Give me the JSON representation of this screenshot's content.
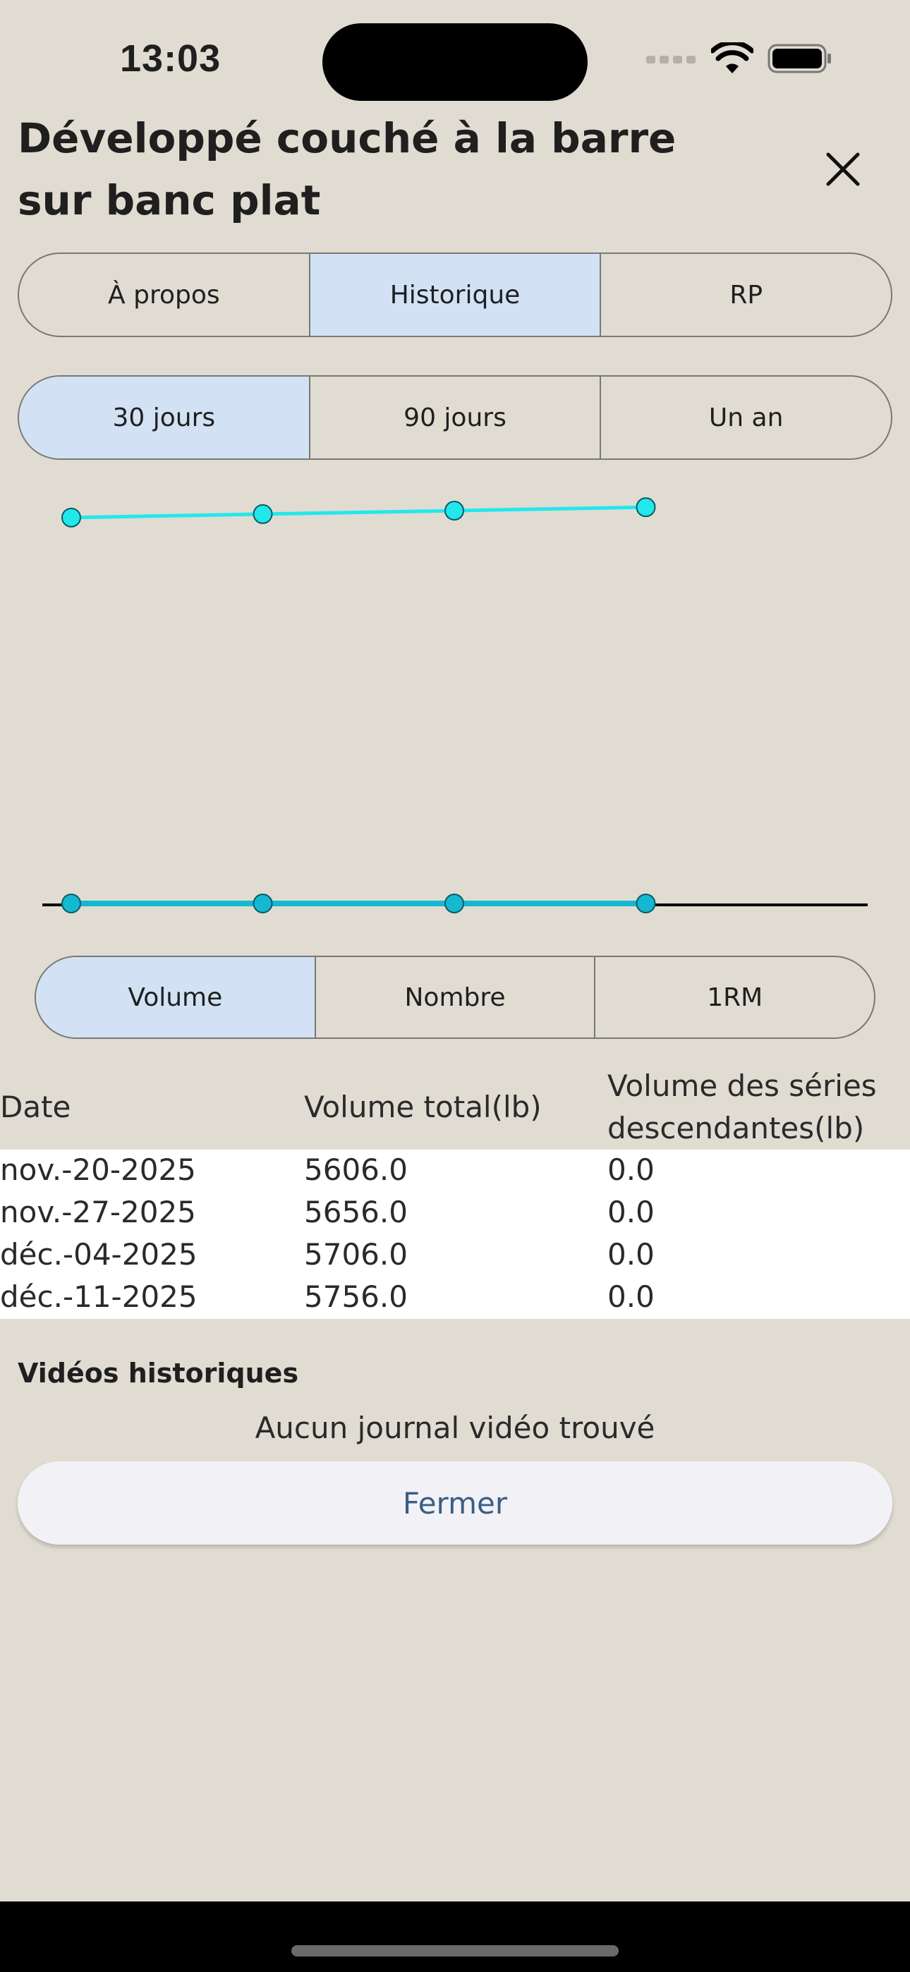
{
  "status": {
    "time": "13:03"
  },
  "header": {
    "title": "Développé couché à la barre sur banc plat"
  },
  "tabs": [
    {
      "label": "À propos",
      "active": false
    },
    {
      "label": "Historique",
      "active": true
    },
    {
      "label": "RP",
      "active": false
    }
  ],
  "ranges": [
    {
      "label": "30 jours",
      "active": true
    },
    {
      "label": "90 jours",
      "active": false
    },
    {
      "label": "Un an",
      "active": false
    }
  ],
  "metrics": [
    {
      "label": "Volume",
      "active": true
    },
    {
      "label": "Nombre",
      "active": false
    },
    {
      "label": "1RM",
      "active": false
    }
  ],
  "chart_data": {
    "type": "line",
    "x": [
      "nov.-20-2025",
      "nov.-27-2025",
      "déc.-04-2025",
      "déc.-11-2025"
    ],
    "series": [
      {
        "values": [
          5606.0,
          5656.0,
          5706.0,
          5756.0
        ],
        "color": "#22e8ec"
      },
      {
        "values": [
          0.0,
          0.0,
          0.0,
          0.0
        ],
        "color": "#14b8d0"
      }
    ],
    "ylim": [
      0,
      5850
    ],
    "grid": false
  },
  "table": {
    "headers": [
      "Date",
      "Volume total(lb)",
      "Volume des séries",
      "descendantes(lb)"
    ],
    "rows": [
      [
        "nov.-20-2025",
        "5606.0",
        "0.0"
      ],
      [
        "nov.-27-2025",
        "5656.0",
        "0.0"
      ],
      [
        "déc.-04-2025",
        "5706.0",
        "0.0"
      ],
      [
        "déc.-11-2025",
        "5756.0",
        "0.0"
      ]
    ]
  },
  "videos": {
    "title": "Vidéos historiques",
    "empty": "Aucun journal vidéo trouvé"
  },
  "actions": {
    "close_label": "Fermer"
  },
  "icons": {
    "close": "close-icon",
    "wifi": "wifi-icon",
    "battery": "battery-icon",
    "signal": "signal-icon"
  }
}
